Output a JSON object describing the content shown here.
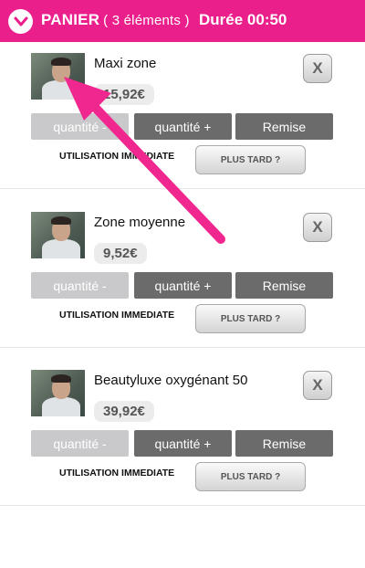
{
  "header": {
    "title": "PANIER",
    "count": "( 3 éléments )",
    "duration": "Durée 00:50",
    "toggle_icon": "chevron-down-circle-icon"
  },
  "items": [
    {
      "name": "Maxi zone",
      "price": "15,92€",
      "remove_label": "X",
      "qty_minus_label": "quantité -",
      "qty_plus_label": "quantité +",
      "discount_label": "Remise",
      "immediate_label": "UTILISATION IMMEDIATE",
      "later_label": "PLUS TARD ?"
    },
    {
      "name": "Zone moyenne",
      "price": "9,52€",
      "remove_label": "X",
      "qty_minus_label": "quantité -",
      "qty_plus_label": "quantité +",
      "discount_label": "Remise",
      "immediate_label": "UTILISATION IMMEDIATE",
      "later_label": "PLUS TARD ?"
    },
    {
      "name": "Beautyluxe oxygénant 50",
      "price": "39,92€",
      "remove_label": "X",
      "qty_minus_label": "quantité -",
      "qty_plus_label": "quantité +",
      "discount_label": "Remise",
      "immediate_label": "UTILISATION IMMEDIATE",
      "later_label": "PLUS TARD ?"
    }
  ],
  "colors": {
    "header_bg": "#ea1f8c",
    "annotation_arrow": "#f0278f",
    "button_dark": "#6b6b6b",
    "button_disabled": "#c9c9cb"
  }
}
